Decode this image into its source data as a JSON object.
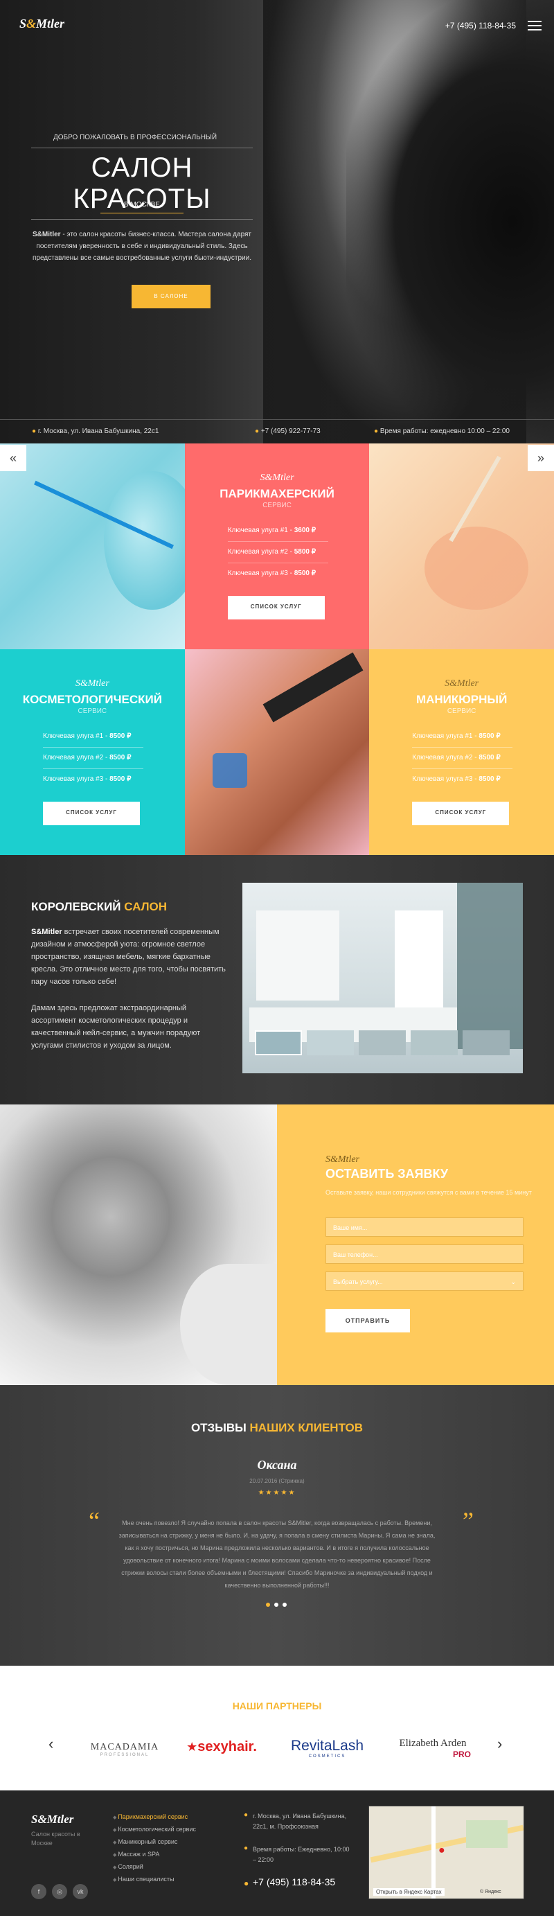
{
  "header": {
    "logo": {
      "left": "S",
      "amp": "&",
      "right": "Mtler"
    },
    "phone": "+7 (495) 118-84-35"
  },
  "hero": {
    "welcome": "ДОБРО ПОЖАЛОВАТЬ В ПРОФЕССИОНАЛЬНЫЙ",
    "title": "САЛОН КРАСОТЫ",
    "city": "В МОСКВЕ",
    "text_bold": "S&Mitler",
    "text": " - это салон красоты бизнес-класса. Мастера салона дарят посетителям уверенность в себе и индивидуальный стиль. Здесь представлены все самые востребованные услуги бьюти-индустрии.",
    "button": "В САЛОНЕ",
    "info_address": "г. Москва, ул. Ивана Бабушкина, 22с1",
    "info_phone": "+7 (495) 922-77-73",
    "info_hours": "Время работы: ежедневно 10:00 – 22:00"
  },
  "services": {
    "prev": "«",
    "next": "»",
    "logo": "S&Mtler",
    "hair": {
      "title": "ПАРИКМАХЕРСКИЙ",
      "sub": "СЕРВИС",
      "rows": [
        {
          "label": "Ключевая улуга #1 -",
          "price": "3600 ₽"
        },
        {
          "label": "Ключевая улуга #2 -",
          "price": "5800 ₽"
        },
        {
          "label": "Ключевая улуга #3 -",
          "price": "8500 ₽"
        }
      ],
      "button": "СПИСОК УСЛУГ"
    },
    "cosmetology": {
      "title": "КОСМЕТОЛОГИЧЕСКИЙ",
      "sub": "СЕРВИС",
      "rows": [
        {
          "label": "Ключевая улуга #1 -",
          "price": "8500 ₽"
        },
        {
          "label": "Ключевая улуга #2 -",
          "price": "8500 ₽"
        },
        {
          "label": "Ключевая улуга #3 -",
          "price": "8500 ₽"
        }
      ],
      "button": "СПИСОК УСЛУГ"
    },
    "manicure": {
      "title": "МАНИКЮРНЫЙ",
      "sub": "СЕРВИС",
      "rows": [
        {
          "label": "Ключевая улуга #1 -",
          "price": "8500 ₽"
        },
        {
          "label": "Ключевая улуга #2 -",
          "price": "8500 ₽"
        },
        {
          "label": "Ключевая улуга #3 -",
          "price": "8500 ₽"
        }
      ],
      "button": "СПИСОК УСЛУГ"
    }
  },
  "royal": {
    "title_white": "КОРОЛЕВСКИЙ",
    "title_yellow": "САЛОН",
    "p1_bold": "S&Mitler",
    "p1": " встречает своих посетителей современным дизайном и атмосферой уюта: огромное светлое пространство, изящная мебель, мягкие бархатные кресла. Это отличное место для того, чтобы посвятить пару часов только себе!",
    "p2": "Дамам здесь предложат экстраординарный ассортимент косметологических процедур и качественный нейл-сервис, а мужчин порадуют услугами стилистов и уходом за лицом."
  },
  "apply": {
    "logo": "S&Mtler",
    "title": "ОСТАВИТЬ ЗАЯВКУ",
    "subtitle": "Оставьте заявку, наши сотрудники свяжутся с вами в течение 15 минут",
    "name_placeholder": "Ваше имя...",
    "phone_placeholder": "Ваш телефон...",
    "service_select": "Выбрать услугу...",
    "button": "ОТПРАВИТЬ"
  },
  "reviews": {
    "title_white": "ОТЗЫВЫ",
    "title_yellow": "НАШИХ КЛИЕНТОВ",
    "name": "Оксана",
    "date": "20.07.2016 (Стрижка)",
    "stars": "★★★★★",
    "open_quote": "“",
    "close_quote": "”",
    "text": "Мне очень повезло! Я случайно попала в салон красоты S&Mitler, когда возвращалась с работы. Времени, записываться на стрижку, у меня не было. И, на удачу, я попала в смену стилиста Марины. Я сама не знала, как я хочу постричься, но Марина предложила несколько вариантов. И в итоге я получила колоссальное удовольствие от конечного итога! Марина с моими волосами сделала что-то невероятно красивое! После стрижки волосы стали более объемными и блестящими! Спасибо Мариночке за индивидуальный подход и качественно выполненной работы!!!"
  },
  "partners": {
    "title": "НАШИ ПАРТНЕРЫ",
    "prev": "‹",
    "next": "›",
    "logos": [
      {
        "name": "MACADAMIA",
        "sub": "PROFESSIONAL"
      },
      {
        "name": "sexyhair."
      },
      {
        "name": "RevitaLash",
        "sub": "COSMETICS"
      },
      {
        "name": "Elizabeth Arden",
        "sub": "PRO"
      }
    ]
  },
  "footer": {
    "logo": "S&Mtler",
    "tagline": "Салон красоты в Москве",
    "menu": [
      "Парикмахерский сервис",
      "Косметологический сервис",
      "Маникюрный сервис",
      "Массаж и SPA",
      "Солярий",
      "Наши специалисты"
    ],
    "address": "г. Москва, ул. Ивана Бабушкина, 22с1, м. Профсоюзная",
    "hours": "Время работы: Ежедневно, 10:00 – 22:00",
    "phone": "+7 (495) 118-84-35",
    "map_link": "Открыть в Яндекс Картах",
    "map_brand": "© Яндекс",
    "social": [
      "f",
      "◎",
      "vk"
    ]
  },
  "colors": {
    "yellow": "#f7b733",
    "coral": "#ff6b6b",
    "cyan": "#1ccfcf",
    "yellow_light": "#ffca5c"
  }
}
